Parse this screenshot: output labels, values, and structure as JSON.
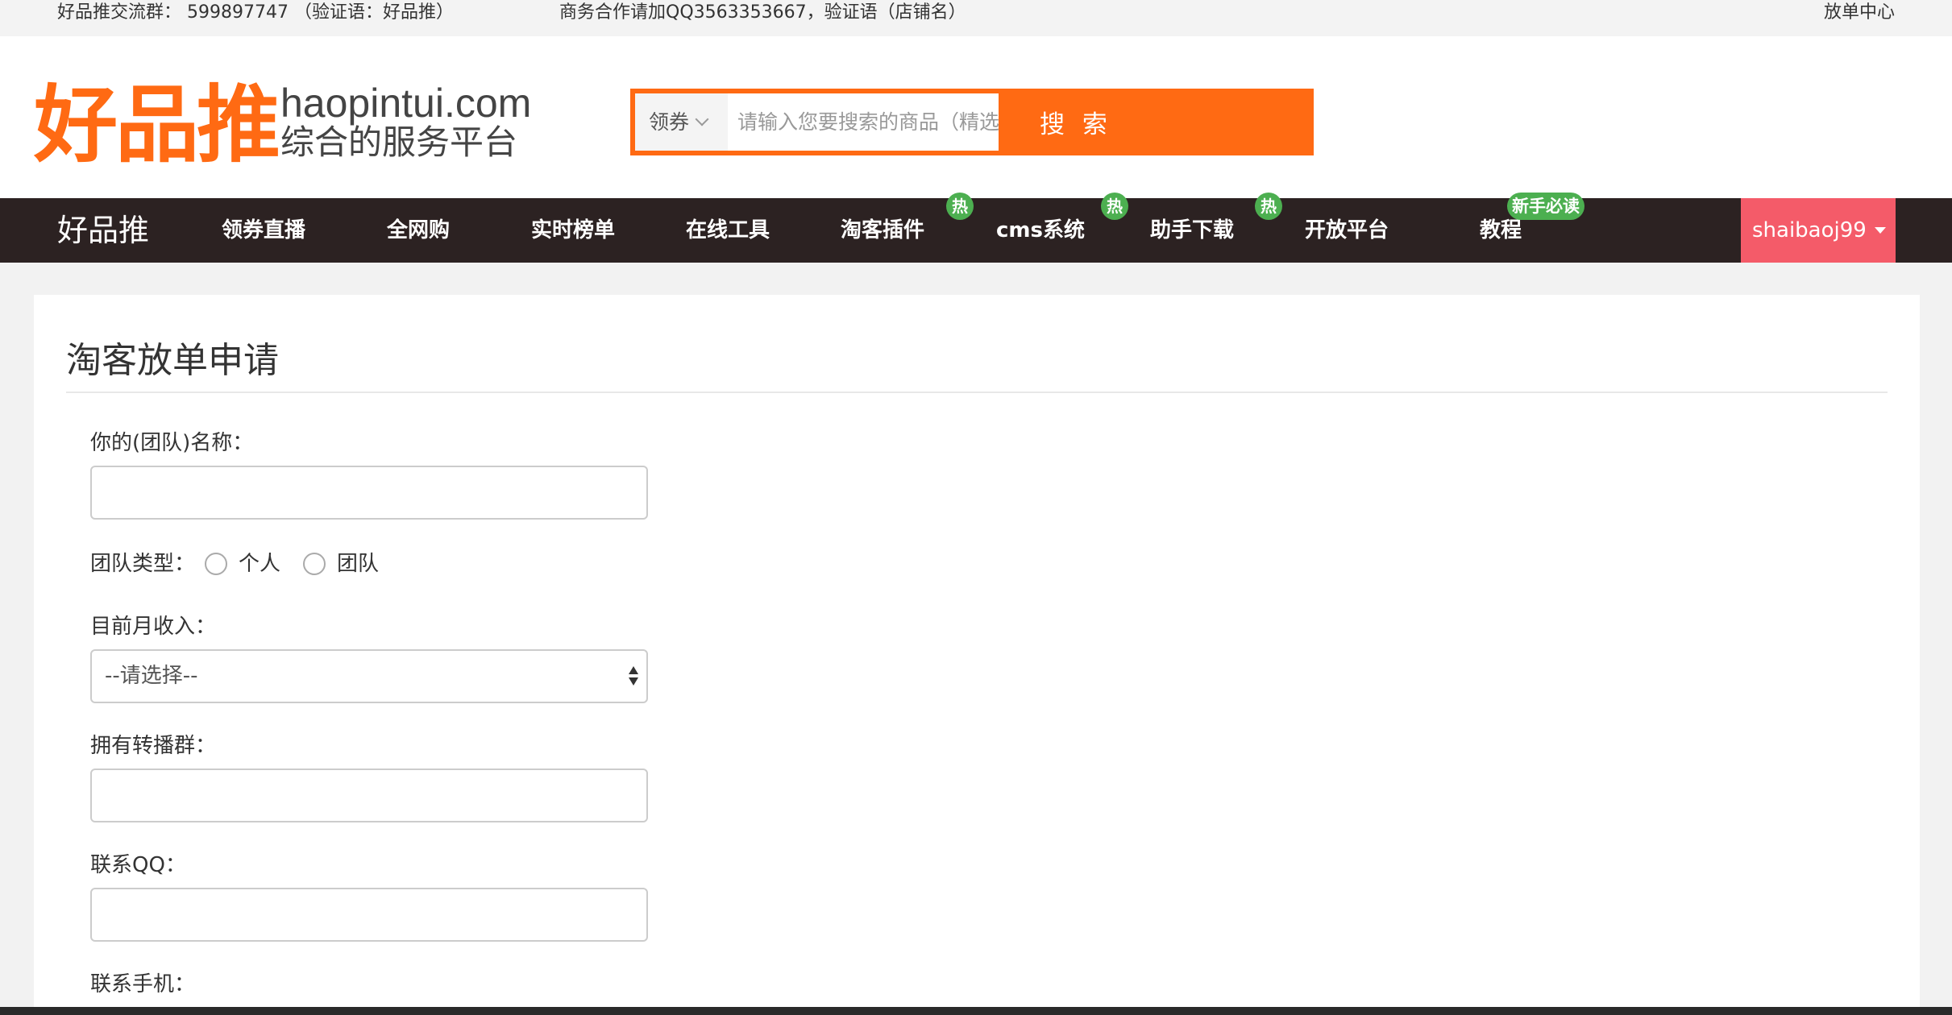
{
  "topbar": {
    "group_text": "好品推交流群： 599897747 （验证语：好品推）",
    "biz_text": "商务合作请加QQ3563353667，验证语（店铺名）",
    "center_link": "放单中心"
  },
  "logo": {
    "cn": "好品推",
    "domain": "haopintui.com",
    "slogan": "综合的服务平台"
  },
  "search": {
    "type_label": "领券",
    "placeholder": "请输入您要搜索的商品（精选）关键词...",
    "button_label": "搜 索"
  },
  "nav": {
    "brand": "好品推",
    "items": [
      "领券直播",
      "全网购",
      "实时榜单",
      "在线工具",
      "淘客插件",
      "cms系统",
      "助手下载",
      "开放平台",
      "教程"
    ],
    "hot_label": "热",
    "new_label": "新手必读",
    "user": "shaibaoj99"
  },
  "form": {
    "title": "淘客放单申请",
    "team_name_label": "你的(团队)名称：",
    "team_type_label": "团队类型：",
    "team_type_options": [
      "个人",
      "团队"
    ],
    "income_label": "目前月收入：",
    "income_selected": "--请选择--",
    "groups_label": "拥有转播群：",
    "qq_label": "联系QQ：",
    "phone_label": "联系手机："
  },
  "colors": {
    "brand_orange": "#ff6a13",
    "nav_bg": "#2c2222",
    "hot_green": "#4caf50",
    "user_pink": "#f45b69"
  }
}
